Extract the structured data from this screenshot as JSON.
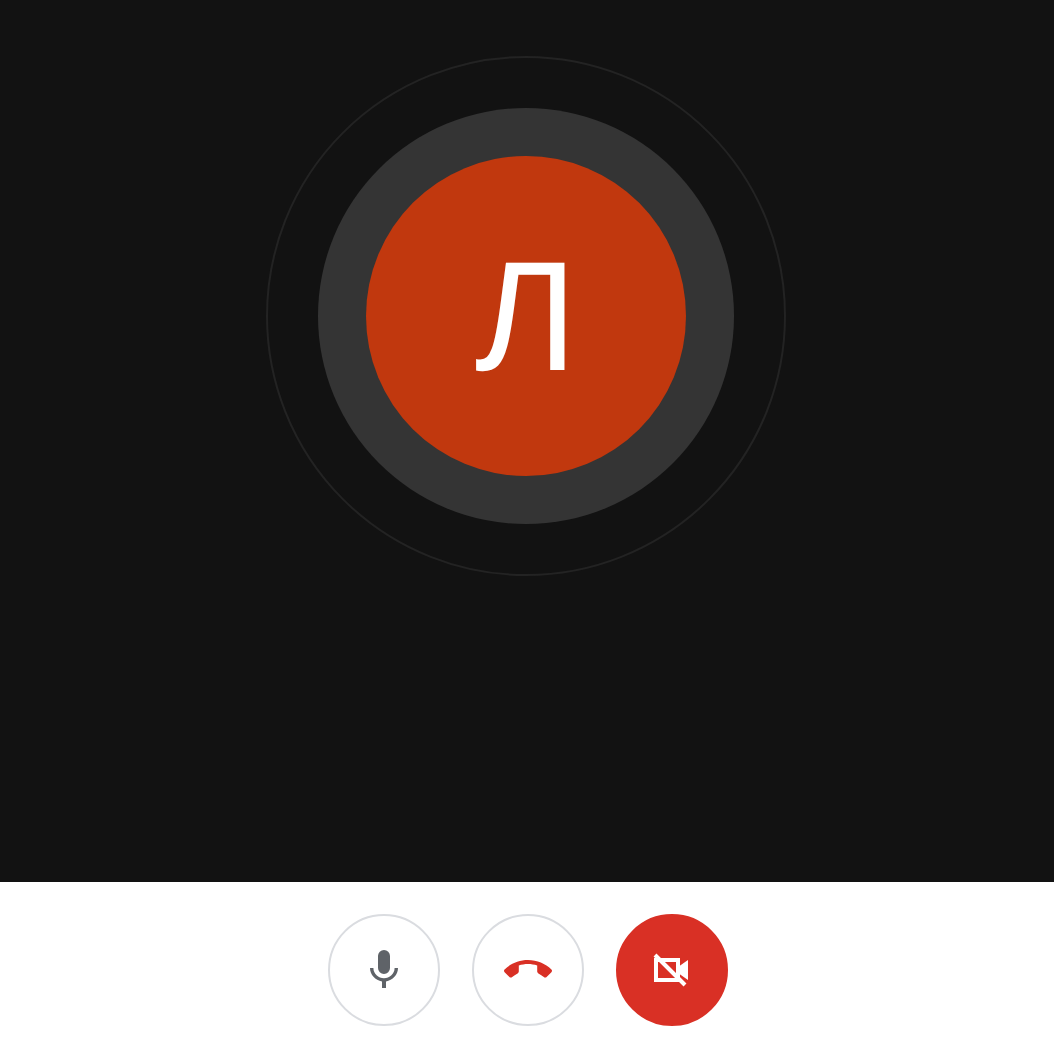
{
  "caller": {
    "initial": "Л"
  },
  "controls": [
    {
      "kind": "mic",
      "on": true
    },
    {
      "kind": "hangup"
    },
    {
      "kind": "camera",
      "on": false
    }
  ]
}
